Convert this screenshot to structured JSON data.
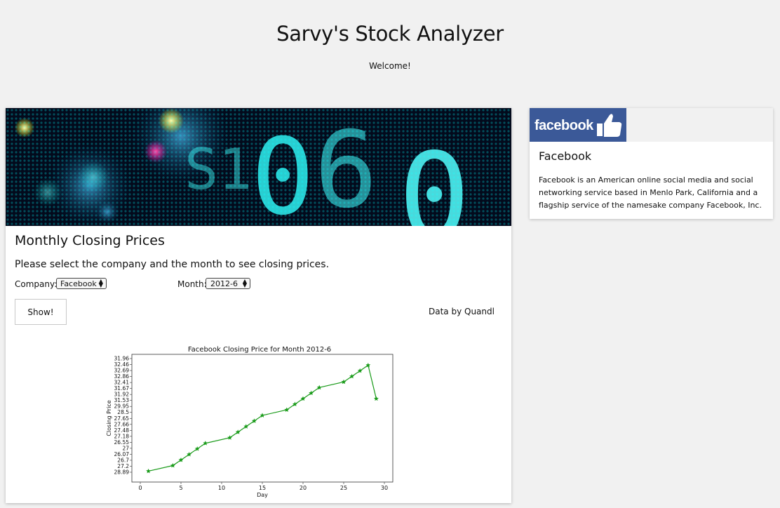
{
  "header": {
    "title": "Sarvy's Stock Analyzer",
    "welcome": "Welcome!"
  },
  "main": {
    "section_title": "Monthly Closing Prices",
    "instructions": "Please select the company and the month to see closing prices.",
    "company_label": "Company:",
    "company_value": "Facebook",
    "month_label": "Month:",
    "month_value": "2012-6",
    "show_button": "Show!",
    "data_credit": "Data by Quandl"
  },
  "sidebar_card": {
    "logo_text": "facebook",
    "title": "Facebook",
    "description": "Facebook is an American online social media and social networking service based in Menlo Park, California and a flagship service of the namesake company Facebook, Inc."
  },
  "colors": {
    "page_background": "#f1f1f1",
    "facebook_blue": "#3b5998",
    "line_color": "#1a9b1a"
  },
  "chart_data": {
    "type": "line",
    "title": "Facebook Closing Price for Month 2012-6",
    "xlabel": "Day",
    "ylabel": "Closing Price",
    "xlim": [
      0,
      30
    ],
    "x_ticks": [
      "0",
      "5",
      "10",
      "15",
      "20",
      "25",
      "30"
    ],
    "y_tick_labels": [
      "28.89",
      "27.2",
      "26.7",
      "26.07",
      "27",
      "26.55",
      "27.18",
      "27.48",
      "27.66",
      "27.65",
      "28.5",
      "29.95",
      "31.53",
      "31.92",
      "31.67",
      "32.41",
      "32.86",
      "32.69",
      "32.46",
      "31.96"
    ],
    "marker": "star",
    "grid": false,
    "series": [
      {
        "x": [
          1,
          4,
          5,
          6,
          7,
          8,
          11,
          12,
          13,
          14,
          15,
          18,
          19,
          20,
          21,
          22,
          25,
          26,
          27,
          28,
          29
        ],
        "y": [
          26.9,
          27.1,
          27.3,
          27.5,
          27.7,
          27.9,
          28.1,
          28.3,
          28.5,
          28.7,
          28.9,
          29.1,
          29.3,
          29.5,
          29.7,
          29.9,
          30.1,
          30.3,
          30.5,
          30.7,
          29.5
        ]
      }
    ]
  }
}
